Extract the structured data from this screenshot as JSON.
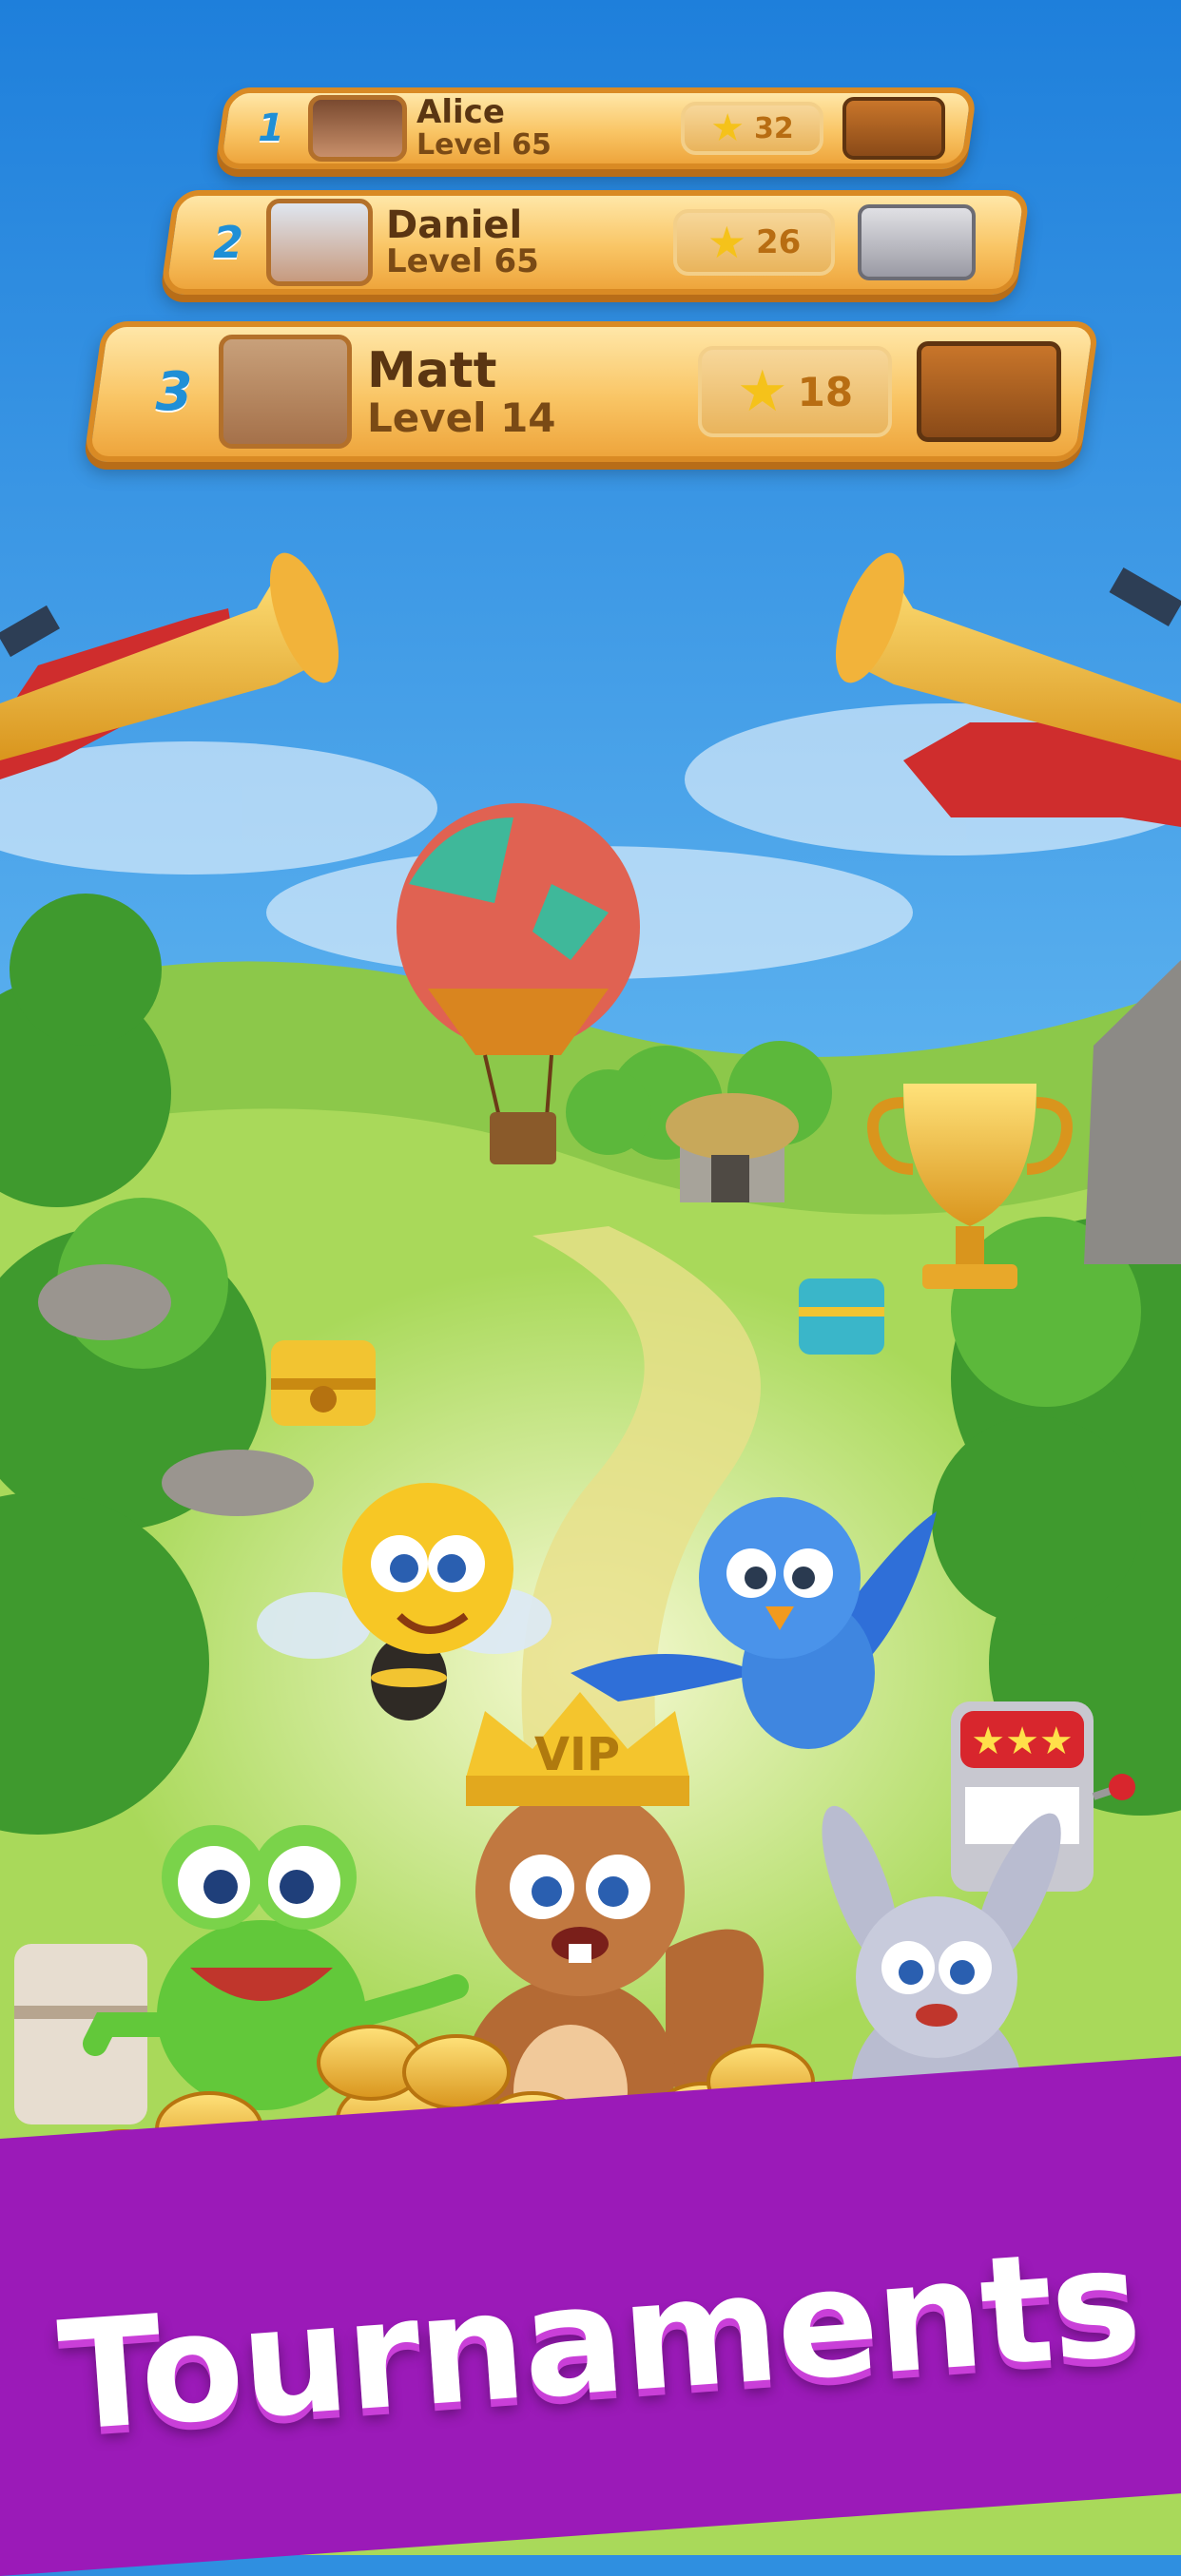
{
  "leaderboard": {
    "players": [
      {
        "rank": "1",
        "name": "Alice",
        "level": "Level 65",
        "stars": "32",
        "chest": "wooden-chest"
      },
      {
        "rank": "2",
        "name": "Daniel",
        "level": "Level 65",
        "stars": "26",
        "chest": "silver-chest"
      },
      {
        "rank": "3",
        "name": "Matt",
        "level": "Level 14",
        "stars": "18",
        "chest": "wooden-chest"
      }
    ]
  },
  "banner": {
    "title": "Tournaments"
  },
  "colors": {
    "sky": "#2f8fe0",
    "banner": "#9b1ab8",
    "row": "#f9c565",
    "rank": "#1f8fd6"
  },
  "scene_objects": [
    "trumpet-icon",
    "hot-air-balloon",
    "trophy-icon",
    "treasure-chest-icon",
    "bee-character",
    "bird-character",
    "frog-character",
    "squirrel-character",
    "bunny-character",
    "slot-machine-icon",
    "gold-coins"
  ]
}
